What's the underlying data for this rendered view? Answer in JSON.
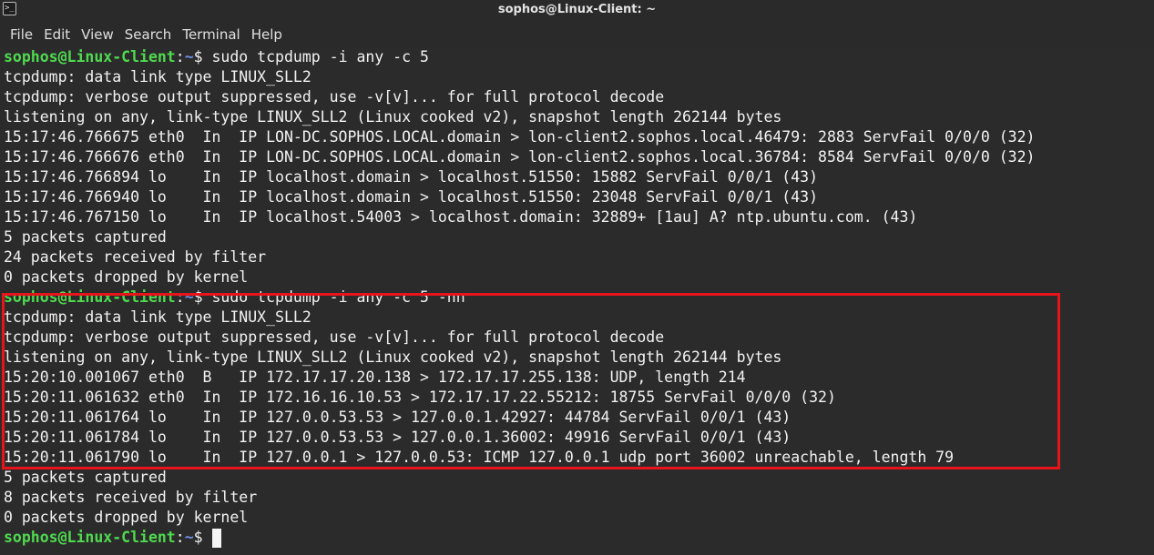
{
  "window": {
    "title": "sophos@Linux-Client: ~"
  },
  "menu": {
    "items": [
      "File",
      "Edit",
      "View",
      "Search",
      "Terminal",
      "Help"
    ]
  },
  "prompt": {
    "user_host": "sophos@Linux-Client",
    "separator": ":",
    "path": "~",
    "symbol": "$"
  },
  "session1": {
    "command": " sudo tcpdump -i any -c 5",
    "output": [
      "tcpdump: data link type LINUX_SLL2",
      "tcpdump: verbose output suppressed, use -v[v]... for full protocol decode",
      "listening on any, link-type LINUX_SLL2 (Linux cooked v2), snapshot length 262144 bytes",
      "15:17:46.766675 eth0  In  IP LON-DC.SOPHOS.LOCAL.domain > lon-client2.sophos.local.46479: 2883 ServFail 0/0/0 (32)",
      "15:17:46.766676 eth0  In  IP LON-DC.SOPHOS.LOCAL.domain > lon-client2.sophos.local.36784: 8584 ServFail 0/0/0 (32)",
      "15:17:46.766894 lo    In  IP localhost.domain > localhost.51550: 15882 ServFail 0/0/1 (43)",
      "15:17:46.766940 lo    In  IP localhost.domain > localhost.51550: 23048 ServFail 0/0/1 (43)",
      "15:17:46.767150 lo    In  IP localhost.54003 > localhost.domain: 32889+ [1au] A? ntp.ubuntu.com. (43)",
      "5 packets captured",
      "24 packets received by filter",
      "0 packets dropped by kernel"
    ]
  },
  "session2": {
    "command": " sudo tcpdump -i any -c 5 -nn",
    "output": [
      "tcpdump: data link type LINUX_SLL2",
      "tcpdump: verbose output suppressed, use -v[v]... for full protocol decode",
      "listening on any, link-type LINUX_SLL2 (Linux cooked v2), snapshot length 262144 bytes",
      "15:20:10.001067 eth0  B   IP 172.17.17.20.138 > 172.17.17.255.138: UDP, length 214",
      "15:20:11.061632 eth0  In  IP 172.16.16.10.53 > 172.17.17.22.55212: 18755 ServFail 0/0/0 (32)",
      "15:20:11.061764 lo    In  IP 127.0.0.53.53 > 127.0.0.1.42927: 44784 ServFail 0/0/1 (43)",
      "15:20:11.061784 lo    In  IP 127.0.0.53.53 > 127.0.0.1.36002: 49916 ServFail 0/0/1 (43)",
      "15:20:11.061790 lo    In  IP 127.0.0.1 > 127.0.0.53: ICMP 127.0.0.1 udp port 36002 unreachable, length 79",
      "5 packets captured",
      "8 packets received by filter",
      "0 packets dropped by kernel"
    ]
  },
  "highlight": {
    "color": "#e8141c"
  }
}
